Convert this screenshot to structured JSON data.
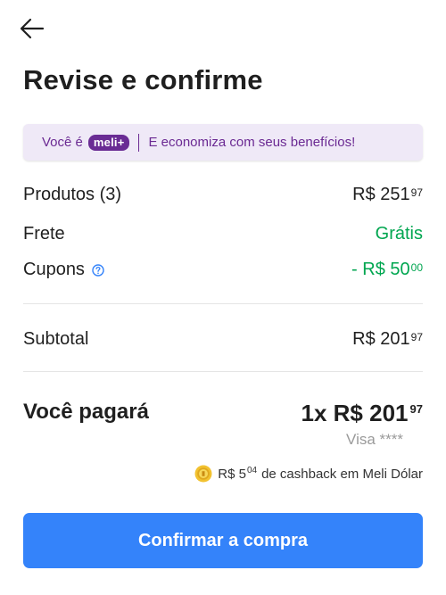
{
  "header": {
    "title": "Revise e confirme",
    "back_icon": "arrow-left-icon"
  },
  "banner": {
    "prefix": "Você é",
    "badge": "meli+",
    "text": "E economiza com seus benefícios!"
  },
  "summary": {
    "products": {
      "label": "Produtos (3)",
      "currency": "R$",
      "amount": "251",
      "cents": "97"
    },
    "shipping": {
      "label": "Frete",
      "value": "Grátis"
    },
    "coupons": {
      "label": "Cupons",
      "sign": "-",
      "currency": "R$",
      "amount": "50",
      "cents": "00",
      "info_icon": "question-circle-icon"
    },
    "subtotal": {
      "label": "Subtotal",
      "currency": "R$",
      "amount": "201",
      "cents": "97"
    }
  },
  "payment": {
    "label": "Você pagará",
    "installments": "1x",
    "currency": "R$",
    "amount": "201",
    "cents": "97",
    "method": "Visa ****"
  },
  "cashback": {
    "icon": "meli-dolar-coin-icon",
    "currency": "R$",
    "amount": "5",
    "cents": "04",
    "text": "de cashback em Meli Dólar"
  },
  "actions": {
    "confirm_label": "Confirmar a compra"
  },
  "colors": {
    "accent": "#3483fa",
    "green": "#00a650",
    "meli_purple": "#6a2c94",
    "banner_bg": "#efe9f7"
  }
}
